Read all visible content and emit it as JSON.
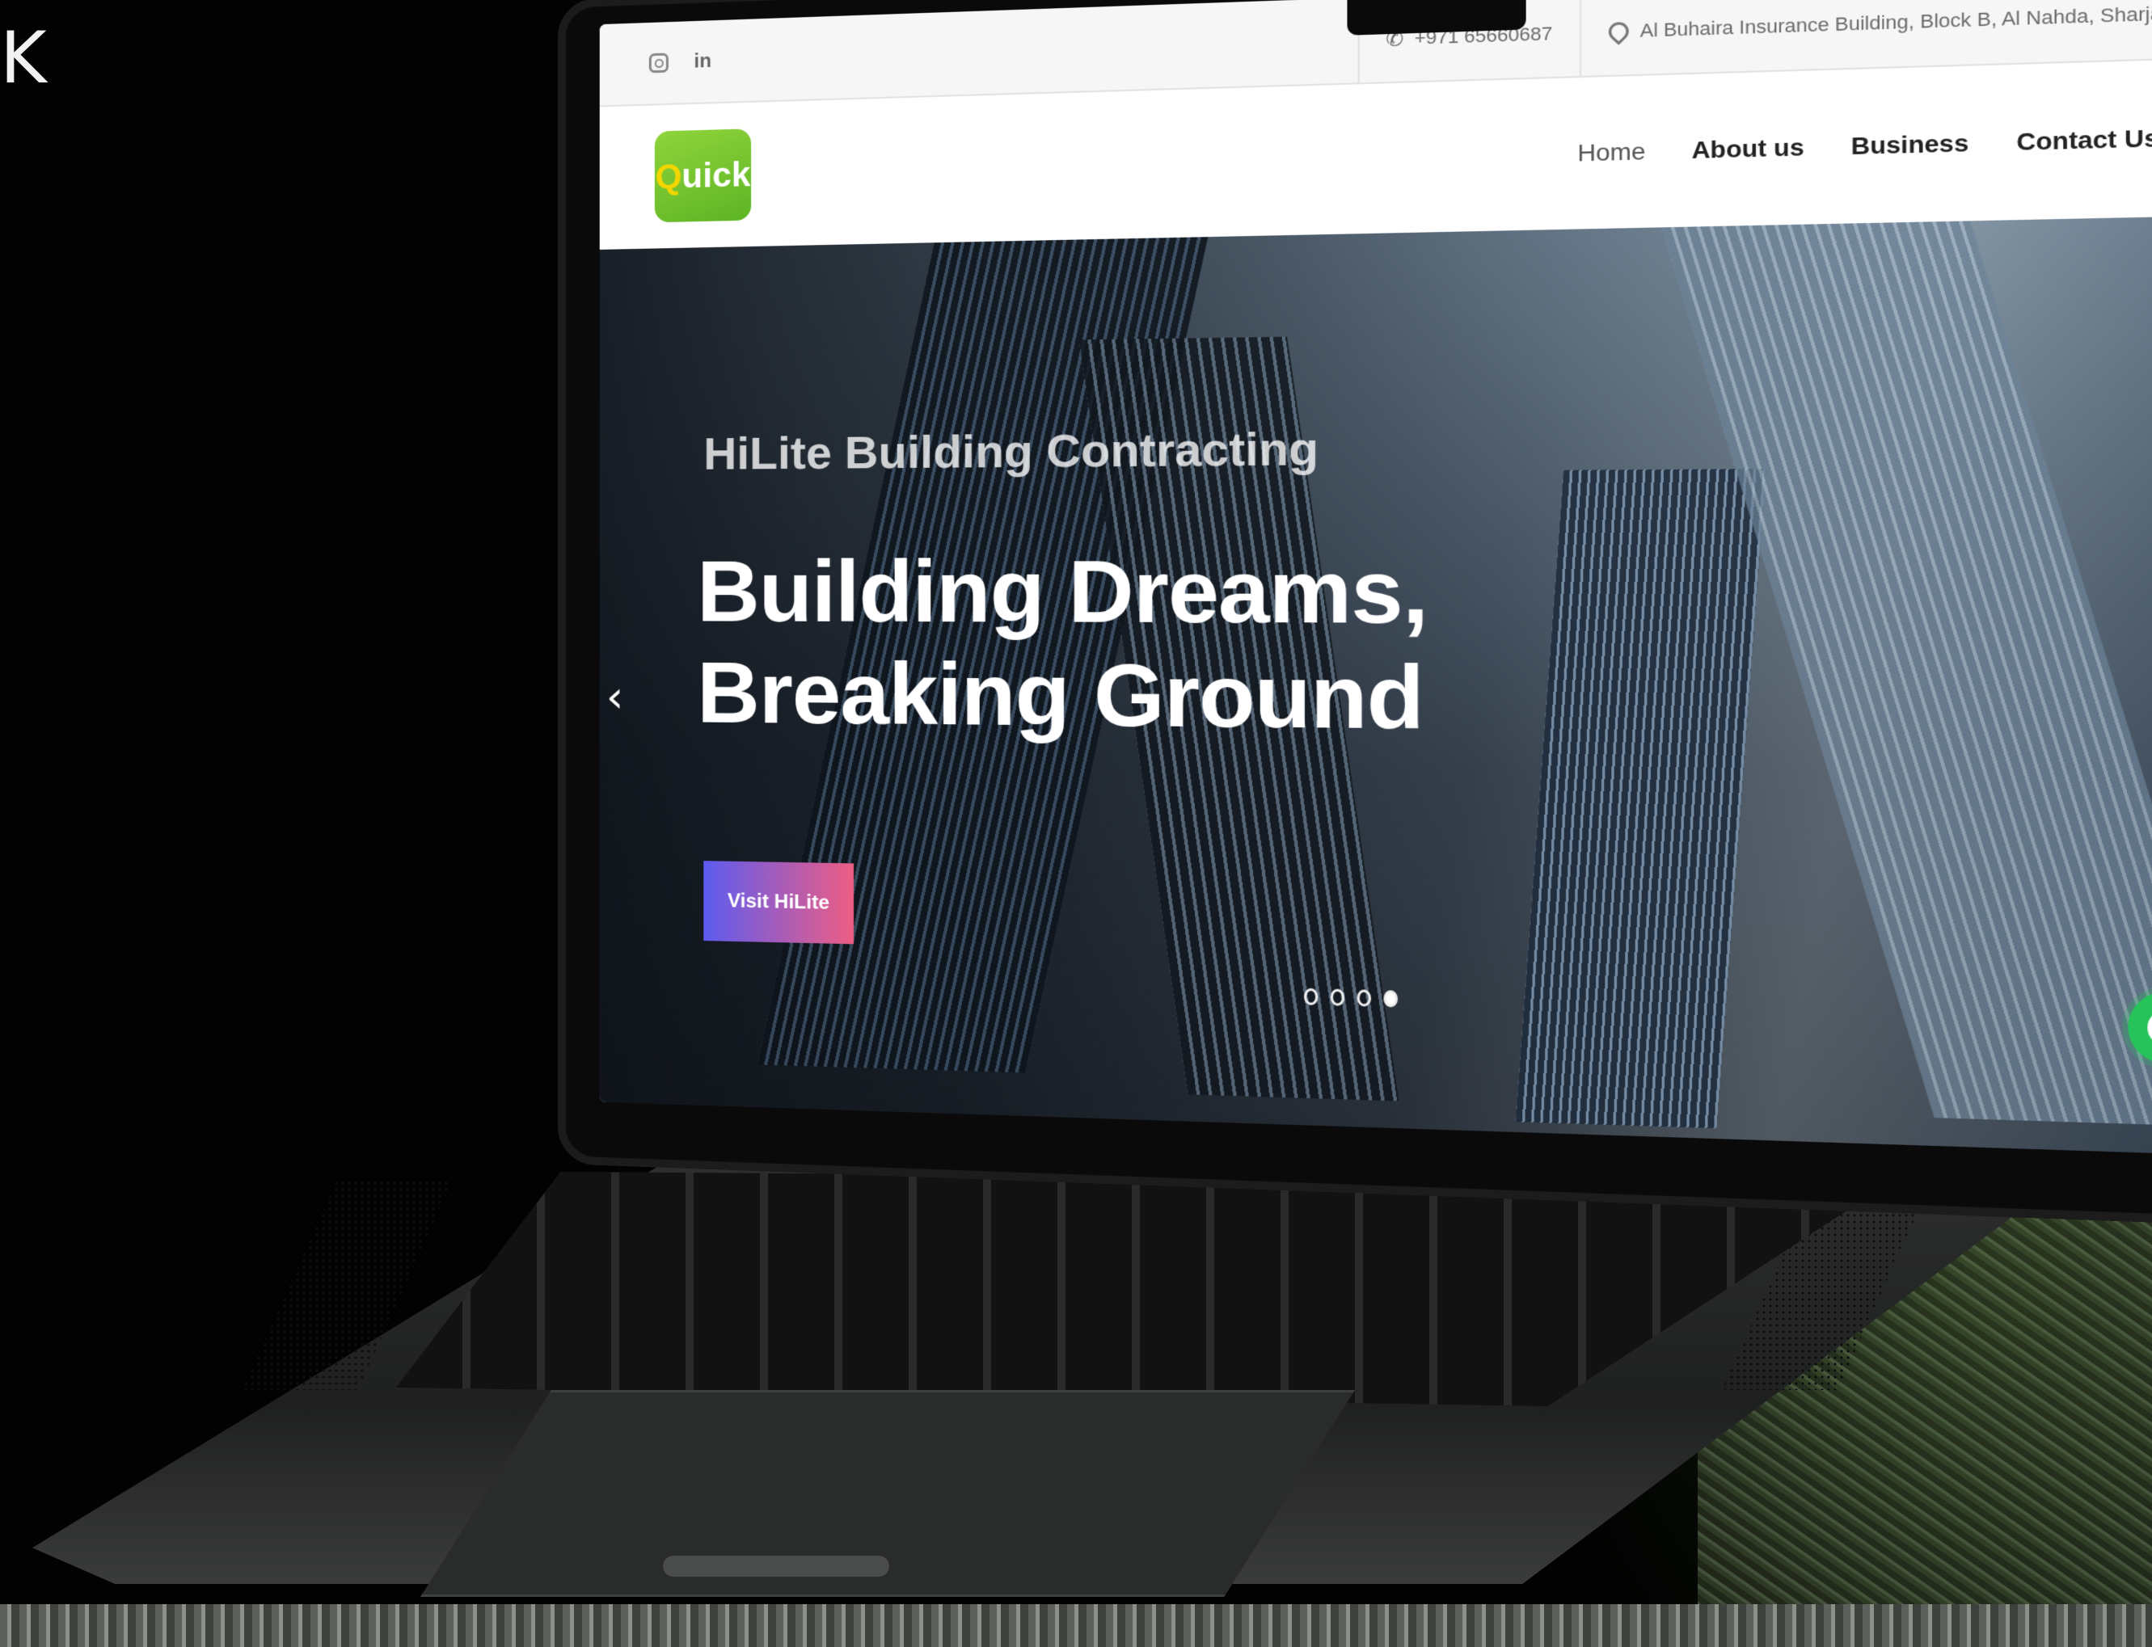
{
  "page": {
    "corner_glyph": "K"
  },
  "topbar": {
    "social": [
      {
        "icon": "instagram-icon"
      },
      {
        "icon": "linkedin-icon",
        "glyph": "in"
      }
    ],
    "phone": "+971 65660687",
    "address": "Al Buhaira Insurance Building, Block B, Al Nahda, Sharjah - UAE"
  },
  "navbar": {
    "logo_text": "uick",
    "logo_mark": "Q",
    "links": [
      {
        "label": "Home",
        "active": true
      },
      {
        "label": "About us",
        "active": false
      },
      {
        "label": "Business",
        "active": false
      },
      {
        "label": "Contact Us",
        "active": false
      }
    ]
  },
  "hero": {
    "subtitle": "HiLite Building Contracting",
    "title_line1": "Building Dreams,",
    "title_line2": "Breaking Ground",
    "cta_label": "Visit HiLite",
    "prev_glyph": "‹",
    "next_glyph": "›",
    "slides_total": 4,
    "active_slide": 4
  },
  "colors": {
    "brand_green": "#6cc22c",
    "cta_gradient_start": "#5c5cf0",
    "cta_gradient_end": "#ee5d83",
    "whatsapp_green": "#25c35a"
  }
}
